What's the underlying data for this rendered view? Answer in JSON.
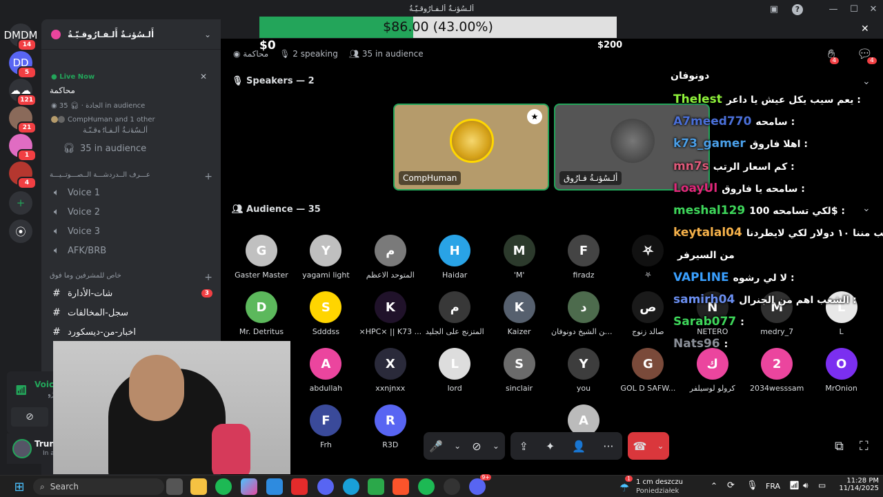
{
  "titlebar": {
    "title": "أَلـسُؤنـةٌ أَلـفـارُوقـيّـةُ",
    "minimize": "—",
    "maximize": "☐",
    "close": "✕",
    "help": "?"
  },
  "donation": {
    "amount_text": "$86.00 (43.00%)",
    "start": "$0",
    "goal": "$200",
    "fraction": 0.43,
    "close": "✕"
  },
  "rail": {
    "servers": [
      {
        "label": "DM",
        "badge": "14",
        "color": "#313338"
      },
      {
        "label": "D",
        "badge": "5",
        "color": "#5865f2"
      },
      {
        "label": "☁",
        "badge": "121",
        "color": "#313338"
      },
      {
        "label": "",
        "badge": "21",
        "color": "#8a6a5a"
      },
      {
        "label": "",
        "badge": "1",
        "color": "#e06cc2"
      },
      {
        "label": "",
        "badge": "4",
        "color": "#b5372f"
      }
    ],
    "add": "+",
    "explore": "⦿"
  },
  "sidebar": {
    "server_name": "أَلـسُؤنـةٌ أَلـفـارُوقـيّـةُ",
    "live_now": "Live Now",
    "stage_name": "محاكمة",
    "stage_info_left": "الجادة",
    "stage_info_audience": "35 in audience",
    "stage_people": "CompHuman and 1 other",
    "row_clip": "ألـسُؤنـةُ ألـفـارُوقـيّـة",
    "audience_row": "35 in audience",
    "voice_category": "عـــرف الــدردشـــة الــصـــوتــيـــة",
    "voice_channels": [
      "Voice 1",
      "Voice 2",
      "Voice 3",
      "AFK/BRB"
    ],
    "private_category": "خاص للمشرفين وما فوق",
    "text_channels": [
      {
        "name": "شات-الأدارة",
        "badge": "3"
      },
      {
        "name": "سجل-المخالفات",
        "badge": ""
      },
      {
        "name": "اخبار-من-ديسكورد",
        "badge": ""
      }
    ],
    "voice_connected": "Voice",
    "voice_sub": "أَلـسُؤنـةٌ أَلـفـارُوقـيّـةُ",
    "user_name": "Trun",
    "user_status": "In a"
  },
  "stage": {
    "stage_title": "محاكمة",
    "speaking": "2 speaking",
    "audience_count": "35 in audience",
    "speakers_title": "Speakers — 2",
    "audience_title": "Audience — 35",
    "speakers": [
      {
        "name": "CompHuman",
        "bg": "#b59b6b"
      },
      {
        "name": "ألـسُؤنـةُ فـارُوق",
        "bg": "#555555"
      }
    ],
    "hand_count": "4",
    "activity_count": "4",
    "audience": [
      {
        "name": "Gaster Master",
        "color": "#c0c0c0",
        "initial": "G"
      },
      {
        "name": "yagami light",
        "color": "#bfbfbf",
        "initial": "Y"
      },
      {
        "name": "المتوحد الاعظم",
        "color": "#7a7a7a",
        "initial": "م"
      },
      {
        "name": "Haidar",
        "color": "#29a3e6",
        "initial": "H"
      },
      {
        "name": "'M'",
        "color": "#2c3a2c",
        "initial": "M"
      },
      {
        "name": "firadz",
        "color": "#444444",
        "initial": "F"
      },
      {
        "name": "⛧",
        "color": "#111111",
        "initial": "⛧"
      },
      {
        "name": "Mr. Detritus",
        "color": "#5cb85c",
        "initial": "D"
      },
      {
        "name": "Sdddss",
        "color": "#ffd500",
        "initial": "S"
      },
      {
        "name": "×HPC× || K73 ...",
        "color": "#20122a",
        "initial": "K"
      },
      {
        "name": "المتزنج على الجليد",
        "color": "#383838",
        "initial": "م"
      },
      {
        "name": "Kaizer",
        "color": "#56606e",
        "initial": "K"
      },
      {
        "name": "من الشيخ دونوفان...",
        "color": "#4d6b4d",
        "initial": "د"
      },
      {
        "name": "صالد زنوج",
        "color": "#1a1a1a",
        "initial": "ص"
      },
      {
        "name": "NETERO",
        "color": "#222222",
        "initial": "N"
      },
      {
        "name": "medry_7",
        "color": "#303030",
        "initial": "M"
      },
      {
        "name": "L",
        "color": "#e8e8e8",
        "initial": "L"
      },
      {
        "name": "abdullah",
        "color": "#eb459e",
        "initial": "A"
      },
      {
        "name": "xxnjnxx",
        "color": "#2a2a3a",
        "initial": "X"
      },
      {
        "name": "lord",
        "color": "#dddddd",
        "initial": "L"
      },
      {
        "name": "sinclair",
        "color": "#6b6b6b",
        "initial": "S"
      },
      {
        "name": "you",
        "color": "#3d3d3d",
        "initial": "Y"
      },
      {
        "name": "GOL D SAFW...",
        "color": "#7a4a3a",
        "initial": "G"
      },
      {
        "name": "كرولو لوسيلفر",
        "color": "#eb459e",
        "initial": "ك"
      },
      {
        "name": "2034wesssam",
        "color": "#eb459e",
        "initial": "2"
      },
      {
        "name": "MrOnion",
        "color": "#7b2ff0",
        "initial": "O"
      },
      {
        "name": "Frh",
        "color": "#3a4a9a",
        "initial": "F"
      },
      {
        "name": "R3D",
        "color": "#5865f2",
        "initial": "R"
      },
      {
        "name": "A",
        "color": "#bbbbbb",
        "initial": "A"
      }
    ]
  },
  "overlay_chat": {
    "header": "دونوفان",
    "messages": [
      {
        "user": "Thelest",
        "text": "يعم سيب يكل عيش يا داعر :",
        "color": "#8ef13a"
      },
      {
        "user": "A7meed770",
        "text": "سامحه :",
        "color": "#4a6fd8"
      },
      {
        "user": "k73_gamer",
        "text": "اهلا فاروق :",
        "color": "#4a9fe8"
      },
      {
        "user": "mn7s",
        "text": "كم اسعار الرتب :",
        "color": "#e05a7a"
      },
      {
        "user": "LoayUl",
        "text": "سامحه يا فاروق :",
        "color": "#e0287a"
      },
      {
        "user": "meshal129",
        "text": "لكي تسامحه 100$ :",
        "color": "#3ed65a"
      },
      {
        "user": "keytalal04",
        "text": "يطلب مننا ١٠ دولار لكي لايطردنا",
        "color": "#f5b14a"
      },
      {
        "user": "",
        "text": "من السيرفر",
        "color": "#ffffff"
      },
      {
        "user": "VAPLINE",
        "text": "لا لي رشوه :",
        "color": "#3aa0ff"
      },
      {
        "user": "samirh04",
        "text": "الشعب اهم من الجنرال :",
        "color": "#6a8ef0"
      },
      {
        "user": "Sarab077",
        "text": ":",
        "color": "#3ed65a"
      },
      {
        "user": "Nats96",
        "text": ":",
        "color": "#8a8f98"
      }
    ]
  },
  "controls": {
    "mic": "🎤",
    "video": "⊘",
    "share": "⇪",
    "activity": "✦",
    "invite": "👤",
    "more": "···",
    "leave": "☎",
    "chevron": "⌄",
    "popout": "⧉",
    "fullscreen": "⛶"
  },
  "taskbar": {
    "search": "Search",
    "weather_temp": "1 cm deszczu",
    "weather_day": "Poniedziałek",
    "lang": "FRA",
    "time": "11:28 PM",
    "date": "11/14/2025",
    "notif_count": "1",
    "discord_badge": "9+"
  }
}
